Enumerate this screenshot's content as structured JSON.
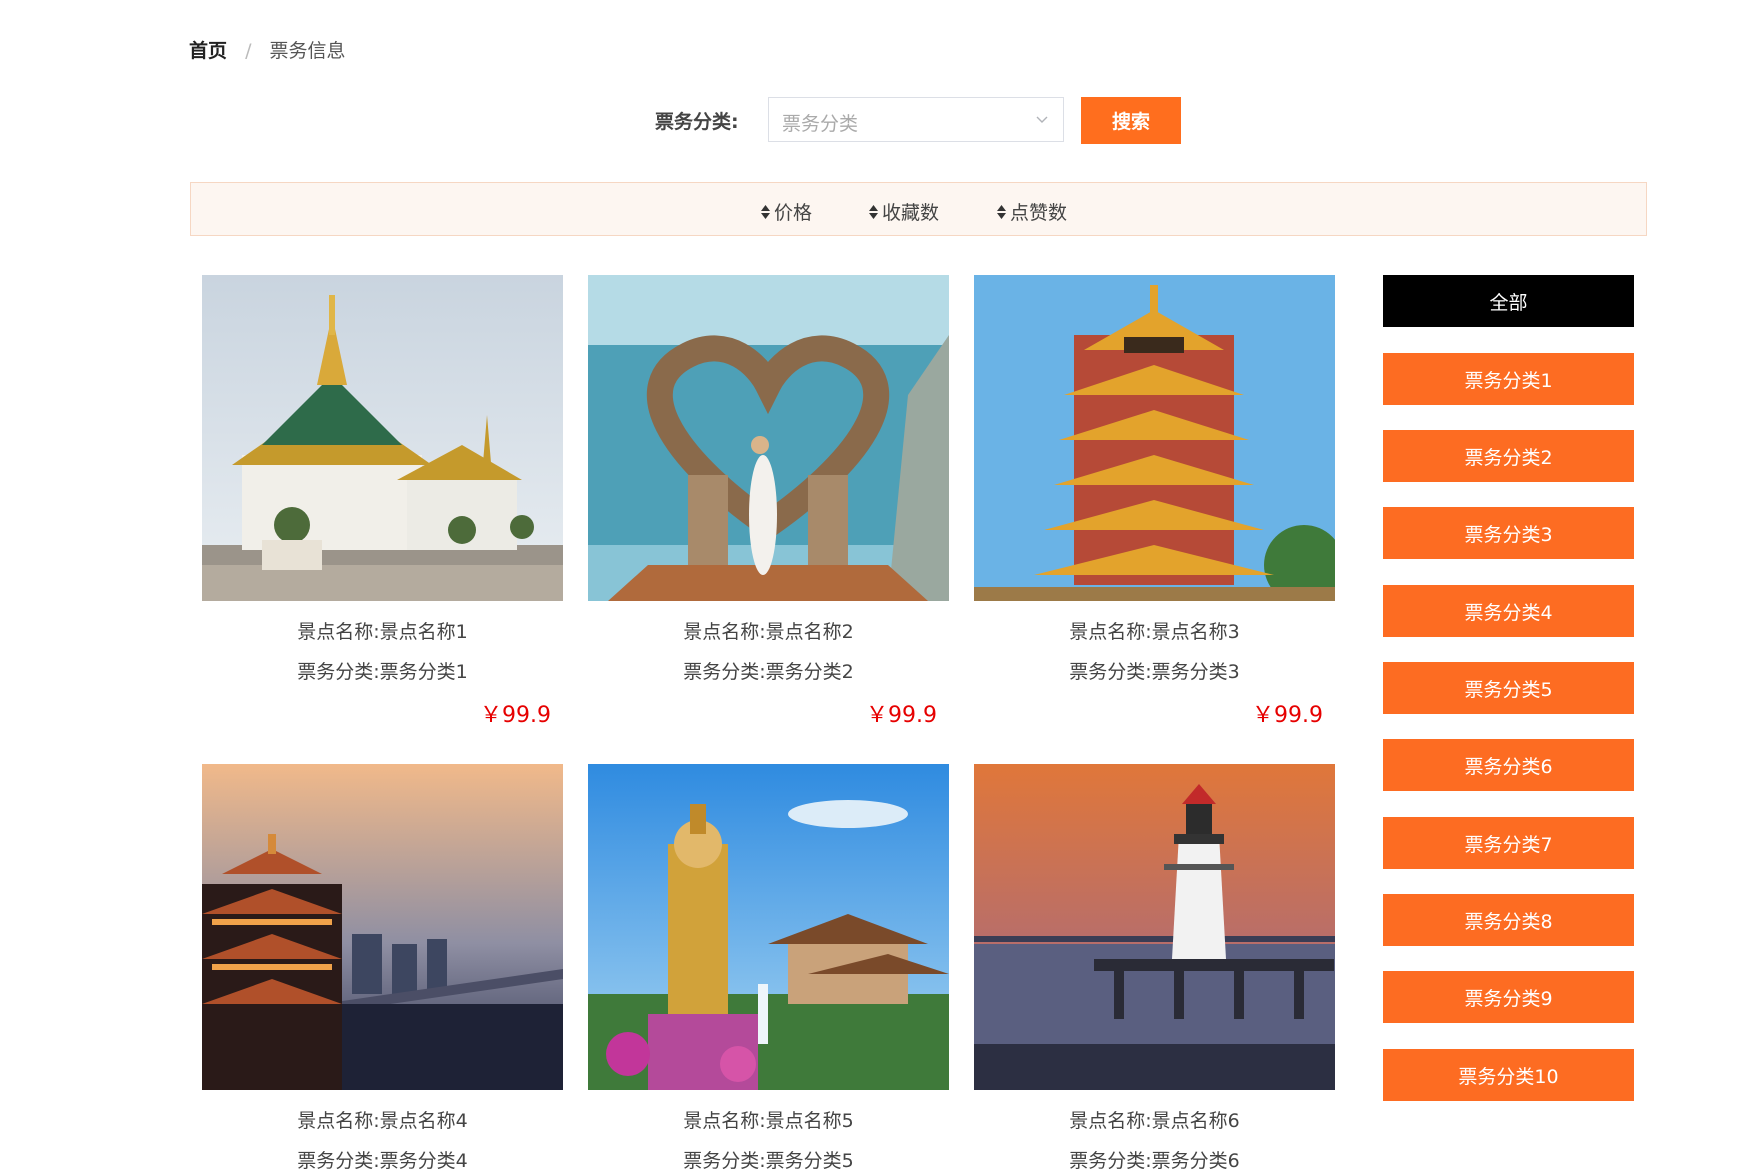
{
  "breadcrumb": {
    "home": "首页",
    "separator": "/",
    "current": "票务信息"
  },
  "search": {
    "label": "票务分类:",
    "placeholder": "票务分类",
    "button": "搜索"
  },
  "sort": [
    {
      "label": "价格"
    },
    {
      "label": "收藏数"
    },
    {
      "label": "点赞数"
    }
  ],
  "items": [
    {
      "name_label": "景点名称:",
      "name": "景点名称1",
      "cat_label": "票务分类:",
      "category": "票务分类1",
      "price": "￥99.9"
    },
    {
      "name_label": "景点名称:",
      "name": "景点名称2",
      "cat_label": "票务分类:",
      "category": "票务分类2",
      "price": "￥99.9"
    },
    {
      "name_label": "景点名称:",
      "name": "景点名称3",
      "cat_label": "票务分类:",
      "category": "票务分类3",
      "price": "￥99.9"
    },
    {
      "name_label": "景点名称:",
      "name": "景点名称4",
      "cat_label": "票务分类:",
      "category": "票务分类4"
    },
    {
      "name_label": "景点名称:",
      "name": "景点名称5",
      "cat_label": "票务分类:",
      "category": "票务分类5"
    },
    {
      "name_label": "景点名称:",
      "name": "景点名称6",
      "cat_label": "票务分类:",
      "category": "票务分类6"
    }
  ],
  "sidebar": {
    "items": [
      "全部",
      "票务分类1",
      "票务分类2",
      "票务分类3",
      "票务分类4",
      "票务分类5",
      "票务分类6",
      "票务分类7",
      "票务分类8",
      "票务分类9",
      "票务分类10"
    ],
    "active_color": "#000000",
    "accent_color": "#fd6c22"
  },
  "colors": {
    "accent": "#ff6e1e",
    "price": "#e60000"
  }
}
